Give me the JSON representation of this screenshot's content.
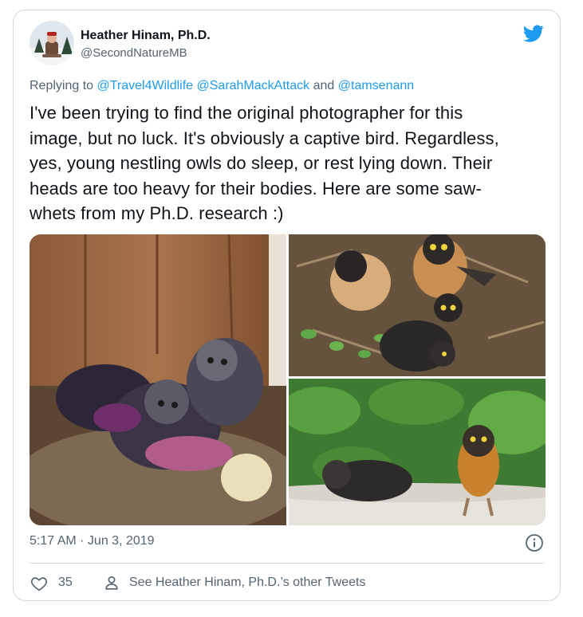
{
  "author": {
    "display_name": "Heather Hinam, Ph.D.",
    "handle": "@SecondNatureMB"
  },
  "reply": {
    "prefix": "Replying to",
    "mentions": [
      "@Travel4Wildlife",
      "@SarahMackAttack",
      "@tamsenann"
    ],
    "joiner": "and"
  },
  "tweet": {
    "lines": [
      "I've been trying to find the original photographer for this",
      "image, but no luck. It's obviously a captive bird. Regardless,",
      "yes, young nestling owls do sleep, or rest lying down. Their",
      "heads are too heavy for their bodies. Here are some saw-",
      "whets from my Ph.D. research :)"
    ]
  },
  "meta": {
    "timestamp": "5:17 AM · Jun 3, 2019"
  },
  "actions": {
    "like_count": "35",
    "see_other": "See Heather Hinam, Ph.D.’s other Tweets"
  },
  "colors": {
    "link": "#1d9bf0",
    "secondary": "#536471",
    "border": "#cfd9de",
    "bird": "#1d9bf0"
  },
  "icons": [
    "twitter-bird-icon",
    "info-icon",
    "heart-icon",
    "user-icon"
  ]
}
